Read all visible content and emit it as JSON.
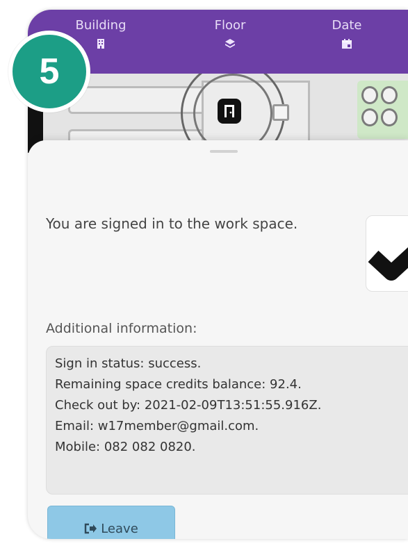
{
  "step_badge": "5",
  "nav": {
    "tabs": [
      {
        "label": "Building",
        "icon": "building-icon"
      },
      {
        "label": "Floor",
        "icon": "layers-icon"
      },
      {
        "label": "Date",
        "icon": "calendar-icon"
      }
    ]
  },
  "sheet": {
    "message": "You are signed in to the work space.",
    "additional_label": "Additional information:",
    "info_lines": [
      "Sign in status: success.",
      "Remaining space credits balance: 92.4.",
      "Check out by: 2021-02-09T13:51:55.916Z.",
      "Email: w17member@gmail.com.",
      "Mobile: 082 082 0820."
    ],
    "leave_button": {
      "label": "Leave",
      "icon": "sign-out-icon"
    }
  },
  "colors": {
    "nav_bg": "#6c3fa6",
    "badge": "#1c9e86",
    "leave_button": "#8ec8e6"
  }
}
